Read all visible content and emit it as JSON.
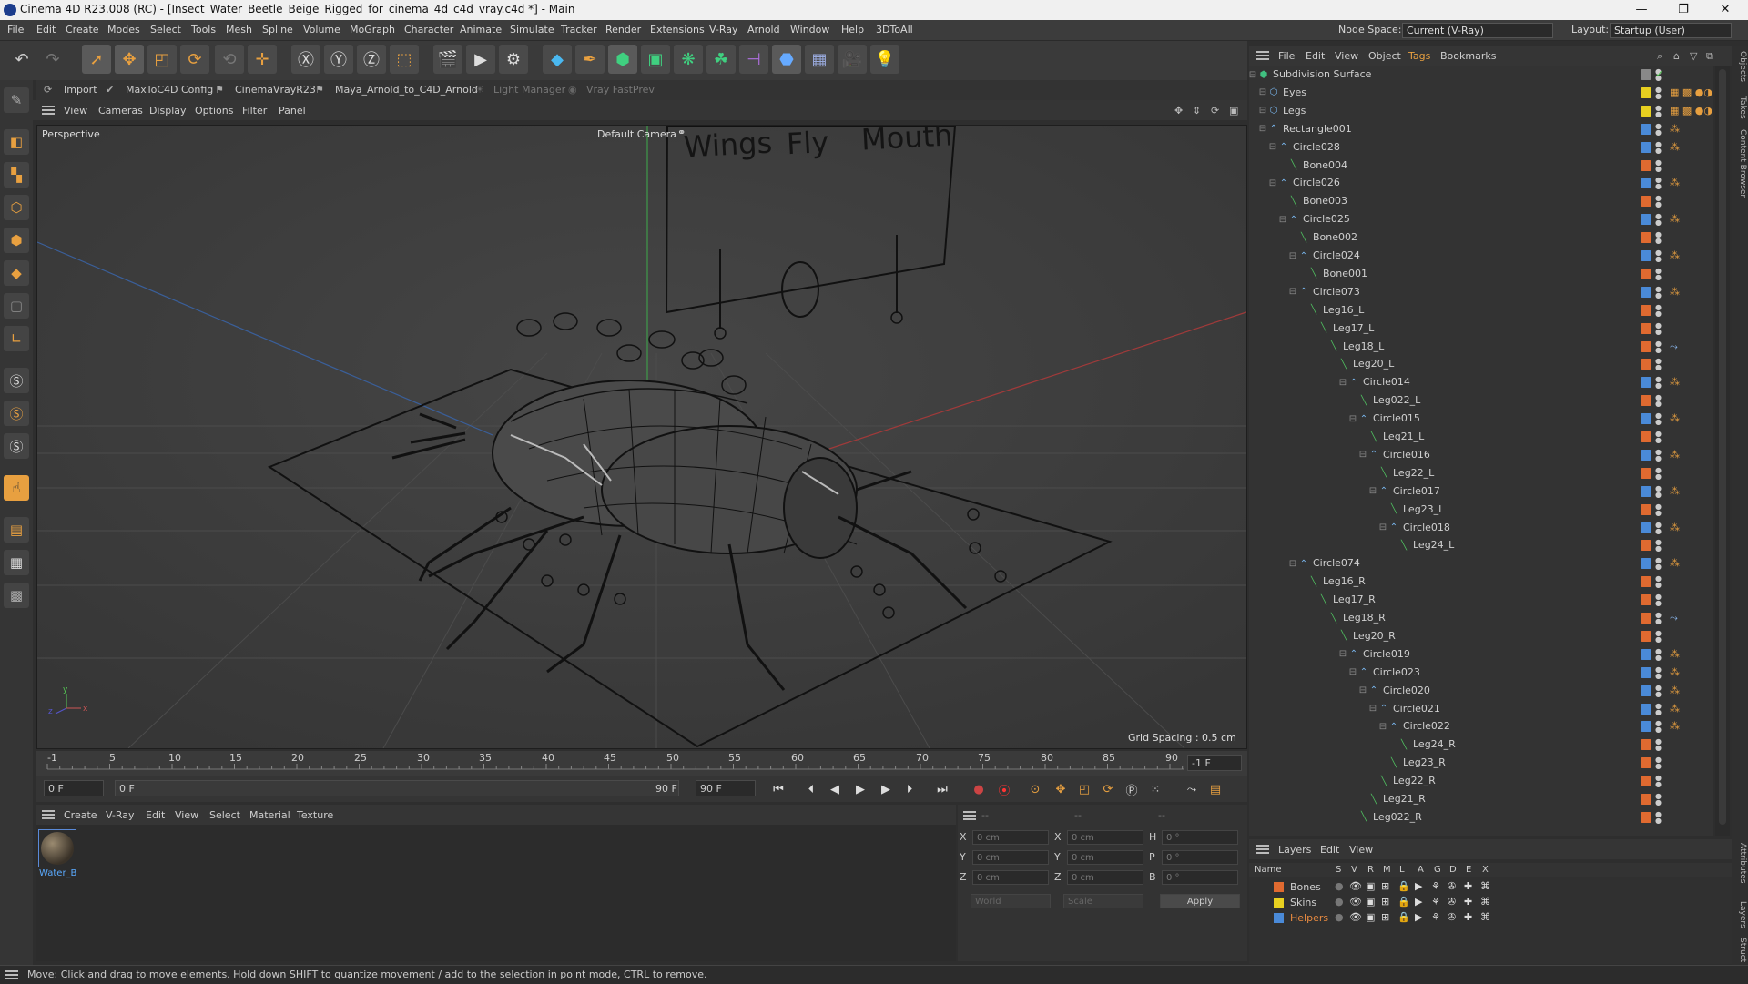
{
  "window": {
    "title": "Cinema 4D R23.008 (RC) - [Insect_Water_Beetle_Beige_Rigged_for_cinema_4d_c4d_vray.c4d *] - Main",
    "min": "—",
    "max": "❐",
    "close": "✕"
  },
  "menubar": {
    "items": [
      "File",
      "Edit",
      "Create",
      "Modes",
      "Select",
      "Tools",
      "Mesh",
      "Spline",
      "Volume",
      "MoGraph",
      "Character",
      "Animate",
      "Simulate",
      "Tracker",
      "Render",
      "Extensions",
      "V-Ray",
      "Arnold",
      "Window",
      "Help",
      "3DToAll"
    ],
    "node_space_label": "Node Space:",
    "node_space_value": "Current (V-Ray)",
    "layout_label": "Layout:",
    "layout_value": "Startup (User)"
  },
  "plugins": {
    "items": [
      "Import",
      "MaxToC4D Config",
      "CinemaVrayR23",
      "Maya_Arnold_to_C4D_Arnold",
      "Light Manager",
      "Vray FastPrev"
    ]
  },
  "viewport": {
    "menu": [
      "View",
      "Cameras",
      "Display",
      "Options",
      "Filter",
      "Panel"
    ],
    "label": "Perspective",
    "camera": "Default Camera",
    "grid_spacing": "Grid Spacing : 0.5 cm",
    "board_text": [
      "Wings",
      "Fly",
      "Mouth"
    ]
  },
  "timeline": {
    "ticks": [
      "-1",
      "5",
      "10",
      "15",
      "20",
      "25",
      "30",
      "35",
      "40",
      "45",
      "50",
      "55",
      "60",
      "65",
      "70",
      "75",
      "80",
      "85",
      "90"
    ],
    "frame_end_field": "-1 F",
    "current_frame": "0 F",
    "start_field": "0 F",
    "end_field": "90 F",
    "max_field": "90 F"
  },
  "material": {
    "menu": [
      "Create",
      "V-Ray",
      "Edit",
      "View",
      "Select",
      "Material",
      "Texture"
    ],
    "items": [
      {
        "name": "Water_B"
      }
    ]
  },
  "coords": {
    "header": [
      "--",
      "--",
      "--"
    ],
    "rows": [
      {
        "a": "X",
        "av": "0 cm",
        "b": "X",
        "bv": "0 cm",
        "c": "H",
        "cv": "0 °"
      },
      {
        "a": "Y",
        "av": "0 cm",
        "b": "Y",
        "bv": "0 cm",
        "c": "P",
        "cv": "0 °"
      },
      {
        "a": "Z",
        "av": "0 cm",
        "b": "Z",
        "bv": "0 cm",
        "c": "B",
        "cv": "0 °"
      }
    ],
    "world": "World",
    "scale": "Scale",
    "apply": "Apply"
  },
  "status": {
    "text": "Move: Click and drag to move elements. Hold down SHIFT to quantize movement / add to the selection in point mode, CTRL to remove."
  },
  "objects": {
    "menu": [
      "File",
      "Edit",
      "View",
      "Object",
      "Tags",
      "Bookmarks"
    ],
    "items": [
      {
        "name": "Subdivision Surface",
        "depth": 0,
        "kind": "subd",
        "color": "#888888",
        "tag": ""
      },
      {
        "name": "Eyes",
        "depth": 1,
        "kind": "null",
        "color": "#e8d020",
        "tag": "mat"
      },
      {
        "name": "Legs",
        "depth": 1,
        "kind": "null",
        "color": "#e8d020",
        "tag": "mat"
      },
      {
        "name": "Rectangle001",
        "depth": 1,
        "kind": "spline",
        "color": "#4a8ad8",
        "tag": "dot"
      },
      {
        "name": "Circle028",
        "depth": 2,
        "kind": "spline",
        "color": "#4a8ad8",
        "tag": "dot"
      },
      {
        "name": "Bone004",
        "depth": 3,
        "kind": "bone",
        "color": "#e06a30",
        "tag": ""
      },
      {
        "name": "Circle026",
        "depth": 2,
        "kind": "spline",
        "color": "#4a8ad8",
        "tag": "dot"
      },
      {
        "name": "Bone003",
        "depth": 3,
        "kind": "bone",
        "color": "#e06a30",
        "tag": ""
      },
      {
        "name": "Circle025",
        "depth": 3,
        "kind": "spline",
        "color": "#4a8ad8",
        "tag": "dot"
      },
      {
        "name": "Bone002",
        "depth": 4,
        "kind": "bone",
        "color": "#e06a30",
        "tag": ""
      },
      {
        "name": "Circle024",
        "depth": 4,
        "kind": "spline",
        "color": "#4a8ad8",
        "tag": "dot"
      },
      {
        "name": "Bone001",
        "depth": 5,
        "kind": "bone",
        "color": "#e06a30",
        "tag": ""
      },
      {
        "name": "Circle073",
        "depth": 4,
        "kind": "spline",
        "color": "#4a8ad8",
        "tag": "dot"
      },
      {
        "name": "Leg16_L",
        "depth": 5,
        "kind": "bone",
        "color": "#e06a30",
        "tag": ""
      },
      {
        "name": "Leg17_L",
        "depth": 6,
        "kind": "bone",
        "color": "#e06a30",
        "tag": ""
      },
      {
        "name": "Leg18_L",
        "depth": 7,
        "kind": "bone",
        "color": "#e06a30",
        "tag": "ik"
      },
      {
        "name": "Leg20_L",
        "depth": 8,
        "kind": "bone",
        "color": "#e06a30",
        "tag": ""
      },
      {
        "name": "Circle014",
        "depth": 9,
        "kind": "spline",
        "color": "#4a8ad8",
        "tag": "dot"
      },
      {
        "name": "Leg022_L",
        "depth": 10,
        "kind": "bone",
        "color": "#e06a30",
        "tag": ""
      },
      {
        "name": "Circle015",
        "depth": 10,
        "kind": "spline",
        "color": "#4a8ad8",
        "tag": "dot"
      },
      {
        "name": "Leg21_L",
        "depth": 11,
        "kind": "bone",
        "color": "#e06a30",
        "tag": ""
      },
      {
        "name": "Circle016",
        "depth": 11,
        "kind": "spline",
        "color": "#4a8ad8",
        "tag": "dot"
      },
      {
        "name": "Leg22_L",
        "depth": 12,
        "kind": "bone",
        "color": "#e06a30",
        "tag": ""
      },
      {
        "name": "Circle017",
        "depth": 12,
        "kind": "spline",
        "color": "#4a8ad8",
        "tag": "dot"
      },
      {
        "name": "Leg23_L",
        "depth": 13,
        "kind": "bone",
        "color": "#e06a30",
        "tag": ""
      },
      {
        "name": "Circle018",
        "depth": 13,
        "kind": "spline",
        "color": "#4a8ad8",
        "tag": "dot"
      },
      {
        "name": "Leg24_L",
        "depth": 14,
        "kind": "bone",
        "color": "#e06a30",
        "tag": ""
      },
      {
        "name": "Circle074",
        "depth": 4,
        "kind": "spline",
        "color": "#4a8ad8",
        "tag": "dot"
      },
      {
        "name": "Leg16_R",
        "depth": 5,
        "kind": "bone",
        "color": "#e06a30",
        "tag": ""
      },
      {
        "name": "Leg17_R",
        "depth": 6,
        "kind": "bone",
        "color": "#e06a30",
        "tag": ""
      },
      {
        "name": "Leg18_R",
        "depth": 7,
        "kind": "bone",
        "color": "#e06a30",
        "tag": "ik"
      },
      {
        "name": "Leg20_R",
        "depth": 8,
        "kind": "bone",
        "color": "#e06a30",
        "tag": ""
      },
      {
        "name": "Circle019",
        "depth": 9,
        "kind": "spline",
        "color": "#4a8ad8",
        "tag": "dot"
      },
      {
        "name": "Circle023",
        "depth": 10,
        "kind": "spline",
        "color": "#4a8ad8",
        "tag": "dot"
      },
      {
        "name": "Circle020",
        "depth": 11,
        "kind": "spline",
        "color": "#4a8ad8",
        "tag": "dot"
      },
      {
        "name": "Circle021",
        "depth": 12,
        "kind": "spline",
        "color": "#4a8ad8",
        "tag": "dot"
      },
      {
        "name": "Circle022",
        "depth": 13,
        "kind": "spline",
        "color": "#4a8ad8",
        "tag": "dot"
      },
      {
        "name": "Leg24_R",
        "depth": 14,
        "kind": "bone",
        "color": "#e06a30",
        "tag": ""
      },
      {
        "name": "Leg23_R",
        "depth": 13,
        "kind": "bone",
        "color": "#e06a30",
        "tag": ""
      },
      {
        "name": "Leg22_R",
        "depth": 12,
        "kind": "bone",
        "color": "#e06a30",
        "tag": ""
      },
      {
        "name": "Leg21_R",
        "depth": 11,
        "kind": "bone",
        "color": "#e06a30",
        "tag": ""
      },
      {
        "name": "Leg022_R",
        "depth": 10,
        "kind": "bone",
        "color": "#e06a30",
        "tag": ""
      }
    ]
  },
  "layers": {
    "menu": [
      "Layers",
      "Edit",
      "View"
    ],
    "header": [
      "Name",
      "S",
      "V",
      "R",
      "M",
      "L",
      "A",
      "G",
      "D",
      "E",
      "X"
    ],
    "items": [
      {
        "name": "Bones",
        "color": "#e06a30",
        "text_color": "#d0d0d0"
      },
      {
        "name": "Skins",
        "color": "#e8d020",
        "text_color": "#d0d0d0"
      },
      {
        "name": "Helpers",
        "color": "#4a8ad8",
        "text_color": "#e88a40"
      }
    ]
  },
  "side_tabs": [
    "Objects",
    "Takes",
    "Content Browser",
    "Attributes",
    "Layers",
    "Struct"
  ]
}
